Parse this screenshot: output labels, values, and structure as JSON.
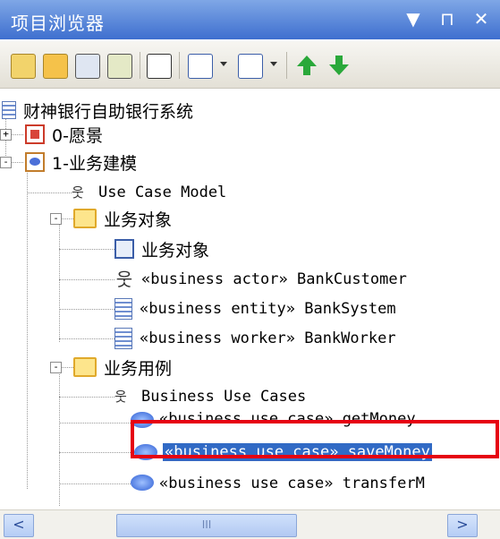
{
  "window": {
    "title": "项目浏览器",
    "controls": [
      "▼",
      "ᵃ",
      "✕"
    ]
  },
  "toolbar": {
    "buttons": [
      "new-package-icon",
      "new-diagram-icon",
      "new-element-icon",
      "element-properties-icon",
      "find-icon",
      "document-icon",
      "report-icon",
      "move-up-icon",
      "move-down-icon"
    ]
  },
  "tree": {
    "root": "财神银行自助银行系统",
    "items": [
      {
        "label": "0-愿景"
      },
      {
        "label": "1-业务建模"
      },
      {
        "label": "Use Case Model"
      },
      {
        "label": "业务对象"
      },
      {
        "label": "业务对象"
      },
      {
        "label": "«business actor» BankCustomer"
      },
      {
        "label": "«business entity» BankSystem"
      },
      {
        "label": "«business worker» BankWorker"
      },
      {
        "label": "业务用例"
      },
      {
        "label": "Business Use Cases"
      },
      {
        "label": "«business use case» getMoney"
      },
      {
        "label": "«business use case» saveMoney"
      },
      {
        "label": "«business use case» transferM"
      }
    ]
  },
  "scrollbar": {
    "left": "<",
    "right": ">",
    "thumb": "III"
  },
  "colors": {
    "titlebar": "#3e6fcf",
    "selection": "#316ac5",
    "highlight_box": "#e60012"
  }
}
